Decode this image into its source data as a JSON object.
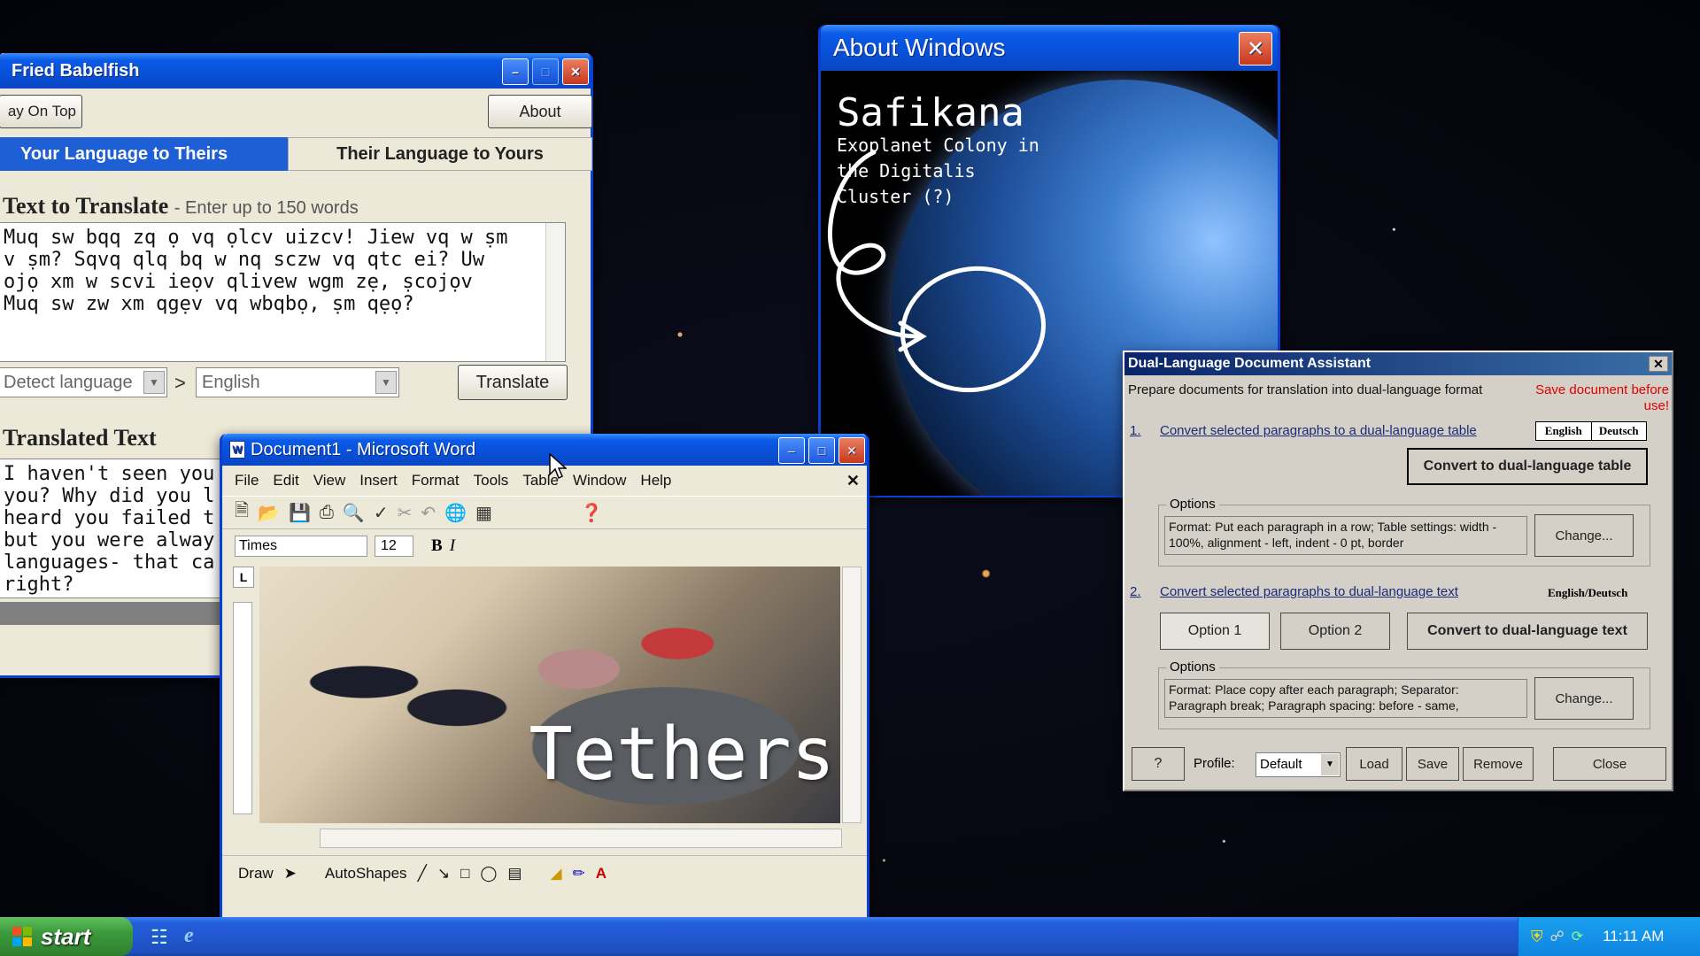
{
  "babelfish": {
    "title": "Fried Babelfish",
    "stay_on_top": "ay On Top",
    "about": "About",
    "tab_active": "Your Language to Theirs",
    "tab_inactive": "Their Language to Yours",
    "text_heading": "Text to Translate",
    "text_hint": "- Enter up to 150 words",
    "source_text": "Muq sw bqq zq ọ vq ọlcv uizcv! Jiew vq w ṣm\nv ṣm? Sqvq qlq bq w nq sczw vq qtc ei? Uw\nojọ xm w scvi ieọv qlivew wgm zẹ, ṣcojọv\nMuq sw zw xm qgẹv vq wbqbọ, ṣm qẹọ?",
    "from_lang": "Detect language",
    "arrow": ">",
    "to_lang": "English",
    "translate": "Translate",
    "translated_heading": "Translated Text",
    "translated_text": "I haven't seen you\nyou? Why did you l\nheard you failed t\nbut you were alway\nlanguages- that ca\nright?"
  },
  "about": {
    "title": "About Windows",
    "planet_name": "Safikana",
    "planet_desc": "Exoplanet Colony in\nthe Digitalis\nCluster (?)"
  },
  "word": {
    "title": "Document1 - Microsoft Word",
    "menu": [
      "File",
      "Edit",
      "View",
      "Insert",
      "Format",
      "Tools",
      "Table",
      "Window",
      "Help"
    ],
    "font_name": "Times",
    "font_size": "12",
    "bold": "B",
    "italic": "I",
    "draw": "Draw",
    "autoshapes": "AutoShapes",
    "overlay_text": "Tethers",
    "ruler_tab": "L"
  },
  "dual": {
    "title": "Dual-Language Document Assistant",
    "intro": "Prepare documents for translation into dual-language format",
    "warning": "Save document before use!",
    "step1_num": "1.",
    "step1": "Convert selected paragraphs to a dual-language table",
    "lang_a": "English",
    "lang_b": "Deutsch",
    "convert_table": "Convert to dual-language table",
    "options_label": "Options",
    "options1_text": "Format: Put each paragraph in a row; Table settings: width - 100%, alignment - left, indent - 0 pt, border",
    "change": "Change...",
    "step2_num": "2.",
    "step2": "Convert selected paragraphs to dual-language text",
    "lang_inline": "English/Deutsch",
    "option1": "Option 1",
    "option2": "Option 2",
    "convert_text": "Convert to dual-language text",
    "options2_text": "Format: Place copy after each paragraph; Separator: Paragraph break; Paragraph spacing: before - same,",
    "help": "?",
    "profile_label": "Profile:",
    "profile_value": "Default",
    "load": "Load",
    "save": "Save",
    "remove": "Remove",
    "close": "Close"
  },
  "taskbar": {
    "start": "start",
    "clock": "11:11 AM"
  },
  "colors": {
    "xp_blue": "#0a5ae8",
    "taskbar": "#245edb",
    "start_green": "#3c9a3c",
    "warning_red": "#e00000"
  }
}
